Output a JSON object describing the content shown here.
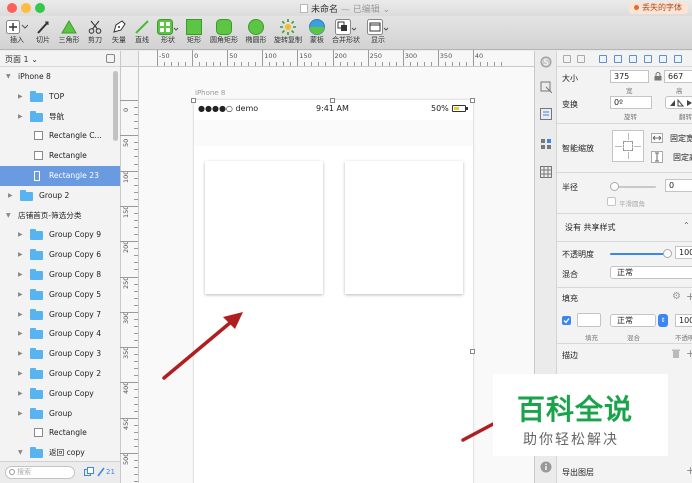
{
  "window": {
    "title": "未命名",
    "title_suffix": "— 已编辑",
    "missing_fonts": "丢失的字体",
    "traffic_colors": [
      "#fc605c",
      "#fdbc40",
      "#34c84a"
    ]
  },
  "toolbar": {
    "tools": [
      {
        "id": "insert",
        "label": "插入",
        "icon": "plus-icon"
      },
      {
        "id": "slice",
        "label": "切片",
        "icon": "slice-icon"
      },
      {
        "id": "triangle",
        "label": "三角形",
        "icon": "triangle-icon"
      },
      {
        "id": "scissors",
        "label": "剪刀",
        "icon": "scissors-icon"
      },
      {
        "id": "vector",
        "label": "矢量",
        "icon": "pen-icon"
      },
      {
        "id": "line",
        "label": "直线",
        "icon": "line-icon"
      },
      {
        "id": "shape",
        "label": "形状",
        "icon": "shape-icon"
      },
      {
        "id": "rect",
        "label": "矩形",
        "icon": "rectangle-icon"
      },
      {
        "id": "rounded",
        "label": "圆角矩形",
        "icon": "rounded-rect-icon"
      },
      {
        "id": "oval",
        "label": "椭圆形",
        "icon": "oval-icon"
      },
      {
        "id": "rotate-copy",
        "label": "旋转复制",
        "icon": "rotate-copy-icon"
      },
      {
        "id": "mask",
        "label": "蒙板",
        "icon": "mask-icon"
      },
      {
        "id": "combine",
        "label": "合并形状",
        "icon": "combine-icon"
      },
      {
        "id": "view",
        "label": "显示",
        "icon": "view-icon"
      }
    ]
  },
  "layers": {
    "page_selector": "页面 1",
    "items": [
      {
        "label": "iPhone 8",
        "depth": 0,
        "kind": "artboard",
        "expanded": true
      },
      {
        "label": "TOP",
        "depth": 1,
        "kind": "folder"
      },
      {
        "label": "导航",
        "depth": 1,
        "kind": "folder"
      },
      {
        "label": "Rectangle C...",
        "depth": 1,
        "kind": "rect"
      },
      {
        "label": "Rectangle",
        "depth": 1,
        "kind": "rect"
      },
      {
        "label": "Rectangle 23",
        "depth": 1,
        "kind": "rect",
        "selected": true
      },
      {
        "label": "Group 2",
        "depth": 0,
        "kind": "folder"
      },
      {
        "label": "店铺首页-筛选分类",
        "depth": 0,
        "kind": "artboard",
        "expanded": true
      },
      {
        "label": "Group Copy 9",
        "depth": 1,
        "kind": "folder"
      },
      {
        "label": "Group Copy 6",
        "depth": 1,
        "kind": "folder"
      },
      {
        "label": "Group Copy 8",
        "depth": 1,
        "kind": "folder"
      },
      {
        "label": "Group Copy 5",
        "depth": 1,
        "kind": "folder"
      },
      {
        "label": "Group Copy 7",
        "depth": 1,
        "kind": "folder"
      },
      {
        "label": "Group Copy 4",
        "depth": 1,
        "kind": "folder"
      },
      {
        "label": "Group Copy 3",
        "depth": 1,
        "kind": "folder"
      },
      {
        "label": "Group Copy 2",
        "depth": 1,
        "kind": "folder"
      },
      {
        "label": "Group Copy",
        "depth": 1,
        "kind": "folder"
      },
      {
        "label": "Group",
        "depth": 1,
        "kind": "folder"
      },
      {
        "label": "Rectangle",
        "depth": 1,
        "kind": "rect"
      },
      {
        "label": "返回 copy",
        "depth": 1,
        "kind": "folder",
        "expanded": true
      }
    ],
    "search_placeholder": "搜索",
    "count": "21"
  },
  "ruler": {
    "top_labels": [
      "-50",
      "0",
      "50",
      "100",
      "150",
      "200",
      "250",
      "300",
      "350",
      "40"
    ],
    "left_labels": [
      "0",
      "50",
      "100",
      "150",
      "200",
      "250",
      "300",
      "350",
      "400",
      "450",
      "500"
    ]
  },
  "canvas": {
    "artboard_name": "iPhone 8",
    "status_signal": "●●●●○ demo",
    "status_time": "9:41 AM",
    "status_battery": "50%",
    "battery_level": 0.5
  },
  "inspector": {
    "size_label": "大小",
    "width": "375",
    "height": "667",
    "width_sub": "宽",
    "height_sub": "高",
    "transform_label": "变换",
    "rotation": "0º",
    "rotation_sub": "旋转",
    "flip_sub": "翻转",
    "smart_resize_label": "智能缩放",
    "fixed_width": "固定宽度",
    "fixed_height": "固定高度",
    "radius_label": "半径",
    "radius_value": "0",
    "smooth_corners": "平滑圆角",
    "shared_style": "没有 共享样式",
    "opacity_label": "不透明度",
    "opacity_value": "100%",
    "opacity_level": 1.0,
    "blend_label": "混合",
    "blend_value": "正常",
    "fill_label": "填充",
    "fill_blend": "正常",
    "fill_opacity": "100%",
    "fill_sub": "填充",
    "fill_blend_sub": "混合",
    "fill_opacity_sub": "不透明度",
    "border_label": "描边",
    "export_label": "导出图层",
    "accent": "#3c86ef"
  },
  "watermark": {
    "main": "百科全说",
    "sub": "助你轻松解决"
  }
}
